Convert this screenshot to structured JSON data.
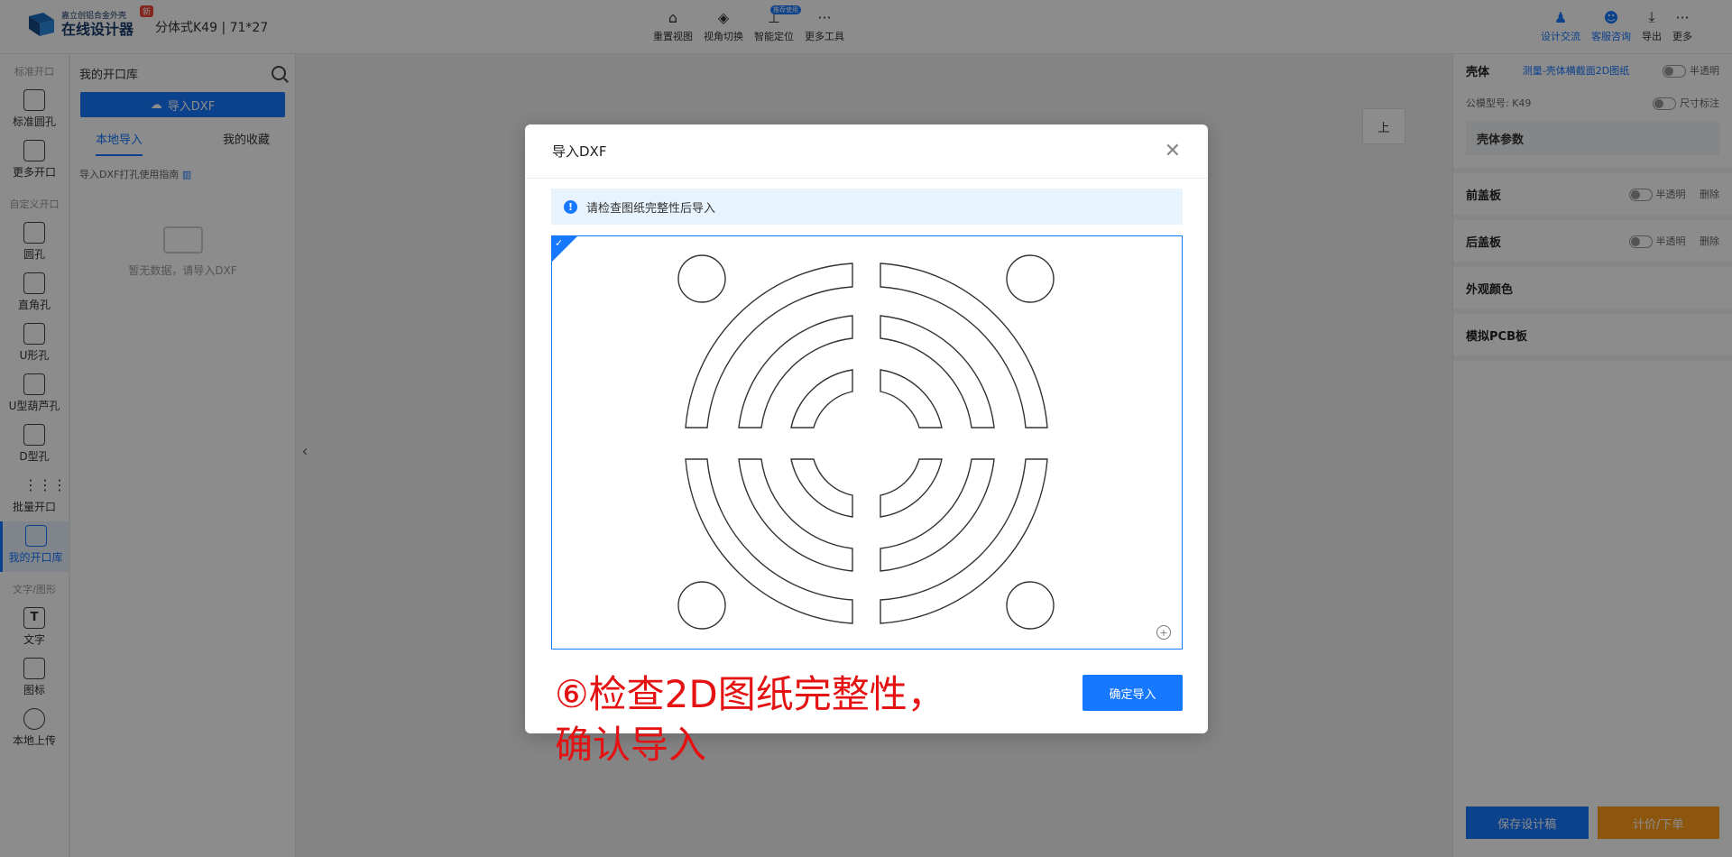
{
  "app": {
    "logo_line1": "嘉立创铝合金外壳",
    "logo_line2": "在线设计器",
    "new_badge": "新",
    "model_name": "分体式K49 | 71*27"
  },
  "toolbar": {
    "center": [
      {
        "label": "重置视图",
        "icon": "home-icon"
      },
      {
        "label": "视角切换",
        "icon": "cube-icon"
      },
      {
        "label": "智能定位",
        "icon": "locate-icon",
        "badge": "推荐使用"
      },
      {
        "label": "更多工具",
        "icon": "more-icon"
      }
    ],
    "right": [
      {
        "label": "设计交流",
        "icon": "community-icon"
      },
      {
        "label": "客服咨询",
        "icon": "support-icon"
      },
      {
        "label": "导出",
        "icon": "download-icon"
      },
      {
        "label": "更多",
        "icon": "more-icon"
      }
    ]
  },
  "rail": {
    "section_standard": "标准开口",
    "section_custom": "自定义开口",
    "section_text": "文字/图形",
    "items": {
      "std_hole": "标准圆孔",
      "more_openings": "更多开口",
      "round_hole": "圆孔",
      "rect_hole": "直角孔",
      "u_hole": "U形孔",
      "u_gourd": "U型葫芦孔",
      "d_hole": "D型孔",
      "batch": "批量开口",
      "my_library": "我的开口库",
      "text": "文字",
      "logo": "图标",
      "upload": "本地上传"
    }
  },
  "library": {
    "title": "我的开口库",
    "import_button": "导入DXF",
    "tabs": [
      "本地导入",
      "我的收藏"
    ],
    "guide_text": "导入DXF打孔使用指南",
    "empty_text": "暂无数据，请导入DXF"
  },
  "view_cube": {
    "face": "上"
  },
  "right_panel": {
    "shell_title": "壳体",
    "shell_link": "测量-壳体横截面2D图纸",
    "half_transparent": "半透明",
    "model_no": "公模型号: K49",
    "dimension_label": "尺寸标注",
    "shell_params": "壳体参数",
    "front_cover": "前盖板",
    "back_cover": "后盖板",
    "delete": "删除",
    "appearance": "外观颜色",
    "pcb": "模拟PCB板",
    "save_button": "保存设计稿",
    "order_button": "计价/下单"
  },
  "modal": {
    "title": "导入DXF",
    "notice": "请检查图纸完整性后导入",
    "confirm_button": "确定导入"
  },
  "caption": {
    "line1": "⑥检查2D图纸完整性，",
    "line2": "确认导入"
  },
  "colors": {
    "primary": "#1677ff",
    "order": "#ff9d1a",
    "caption": "#e41212"
  }
}
